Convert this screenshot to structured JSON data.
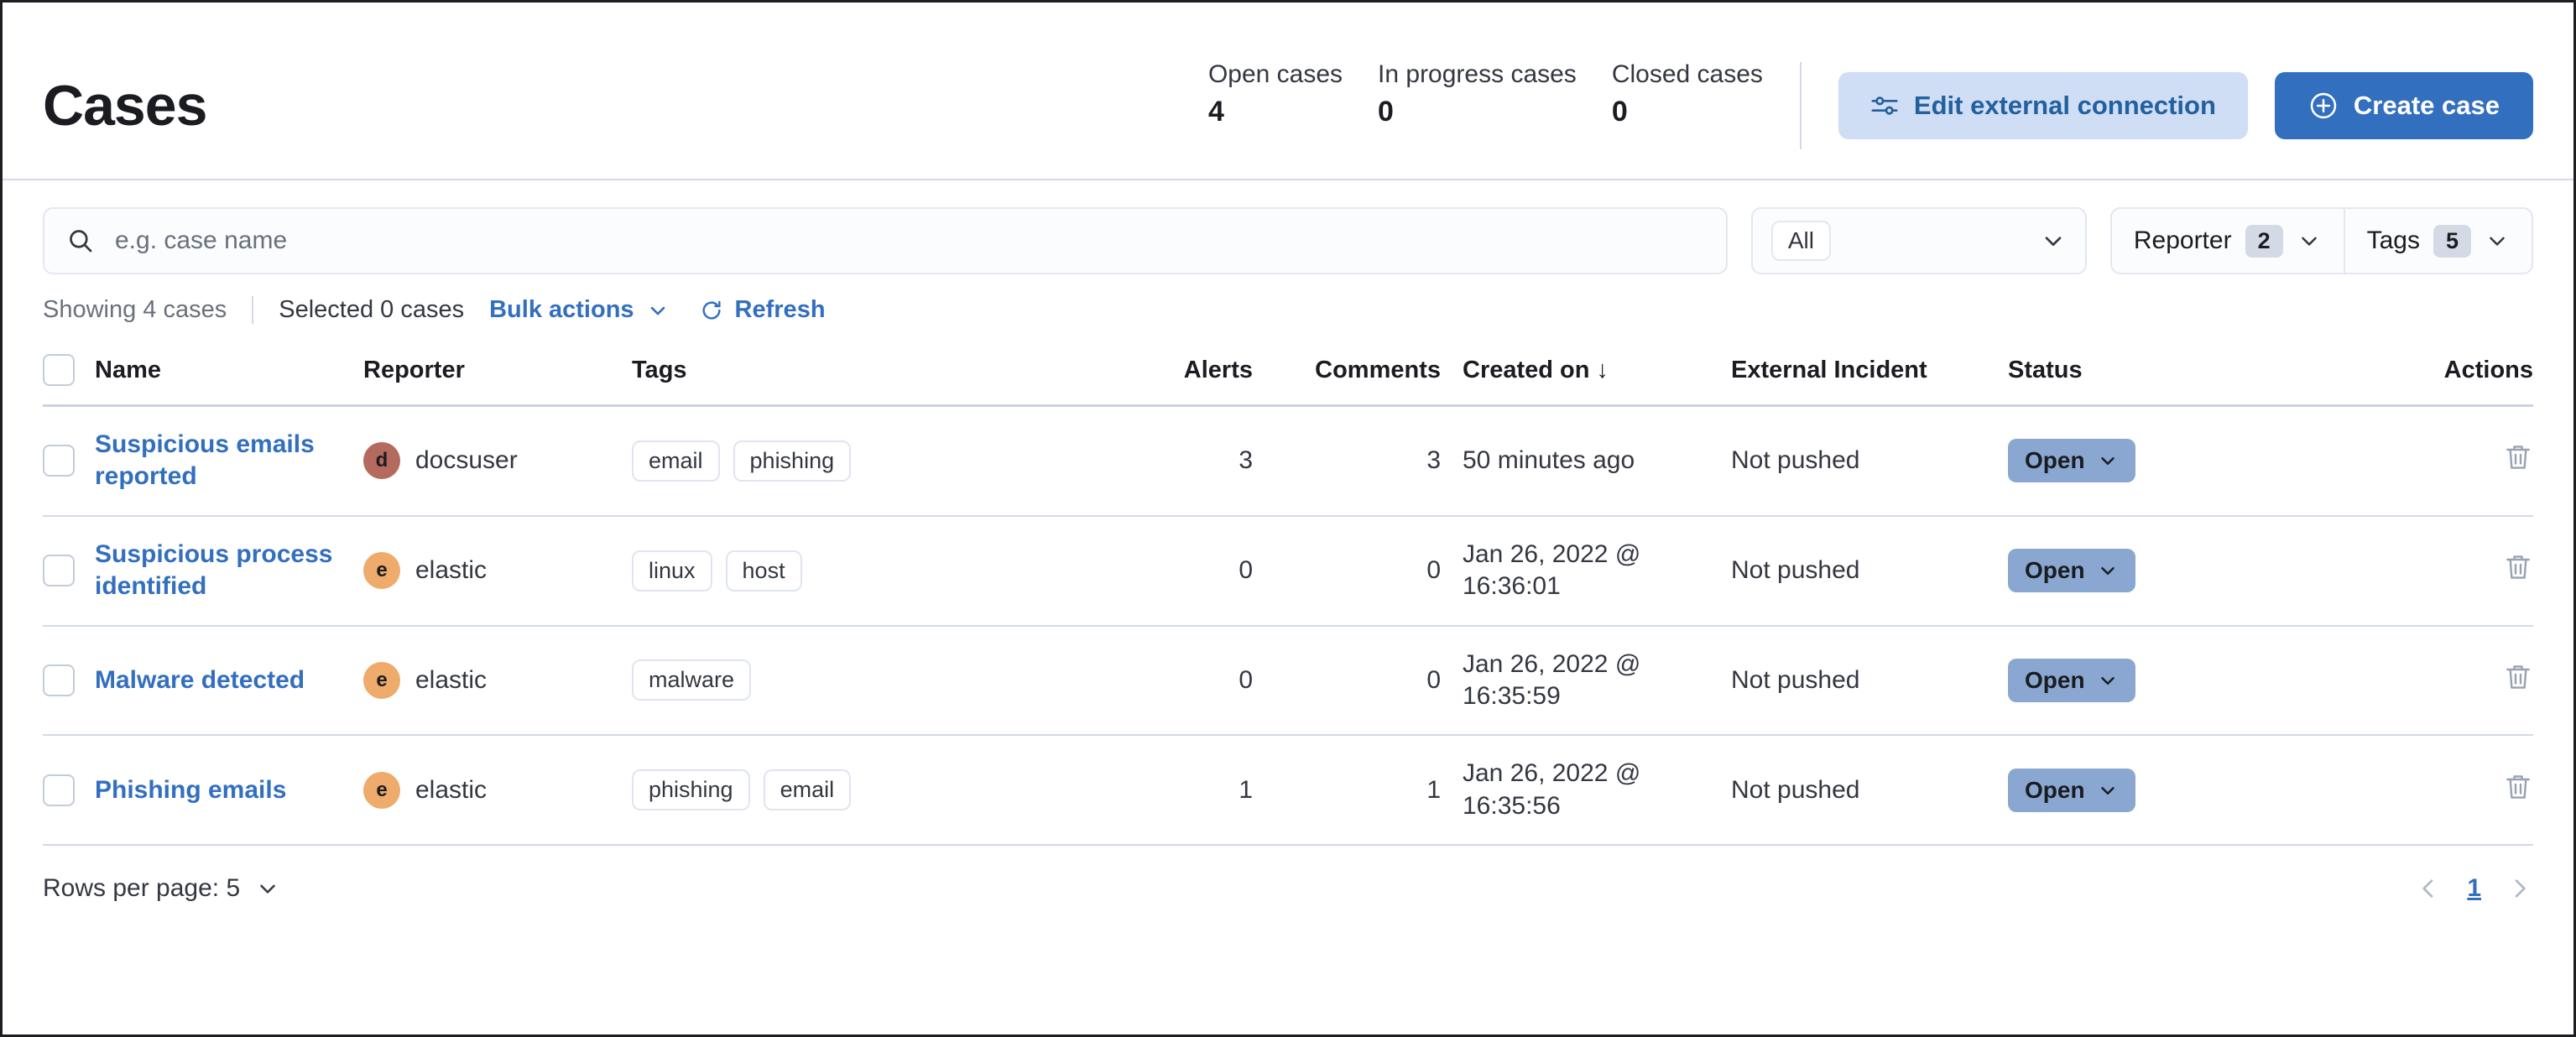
{
  "header": {
    "title": "Cases",
    "stats": [
      {
        "label": "Open cases",
        "value": "4"
      },
      {
        "label": "In progress cases",
        "value": "0"
      },
      {
        "label": "Closed cases",
        "value": "0"
      }
    ],
    "edit_connection_label": "Edit external connection",
    "create_case_label": "Create case",
    "accent_primary": "#336fbf",
    "accent_secondary_bg": "#cfddf5"
  },
  "filters": {
    "search_placeholder": "e.g. case name",
    "severity_value": "All",
    "reporter_label": "Reporter",
    "reporter_count": "2",
    "tags_label": "Tags",
    "tags_count": "5"
  },
  "toolbar": {
    "showing": "Showing 4 cases",
    "selected": "Selected 0 cases",
    "bulk_actions": "Bulk actions",
    "refresh": "Refresh"
  },
  "table": {
    "columns": {
      "name": "Name",
      "reporter": "Reporter",
      "tags": "Tags",
      "alerts": "Alerts",
      "comments": "Comments",
      "created_on": "Created on",
      "sort_arrow": "↓",
      "external_incident": "External Incident",
      "status": "Status",
      "actions": "Actions"
    },
    "rows": [
      {
        "name": "Suspicious emails reported",
        "reporter": "docsuser",
        "avatar_initial": "d",
        "avatar_color": "#b56a5e",
        "tags": [
          "email",
          "phishing"
        ],
        "alerts": "3",
        "comments": "3",
        "created_on": "50 minutes ago",
        "external_incident": "Not pushed",
        "status": "Open"
      },
      {
        "name": "Suspicious process identified",
        "reporter": "elastic",
        "avatar_initial": "e",
        "avatar_color": "#eeab6b",
        "tags": [
          "linux",
          "host"
        ],
        "alerts": "0",
        "comments": "0",
        "created_on": "Jan 26, 2022 @ 16:36:01",
        "external_incident": "Not pushed",
        "status": "Open"
      },
      {
        "name": "Malware detected",
        "reporter": "elastic",
        "avatar_initial": "e",
        "avatar_color": "#eeab6b",
        "tags": [
          "malware"
        ],
        "alerts": "0",
        "comments": "0",
        "created_on": "Jan 26, 2022 @ 16:35:59",
        "external_incident": "Not pushed",
        "status": "Open"
      },
      {
        "name": "Phishing emails",
        "reporter": "elastic",
        "avatar_initial": "e",
        "avatar_color": "#eeab6b",
        "tags": [
          "phishing",
          "email"
        ],
        "alerts": "1",
        "comments": "1",
        "created_on": "Jan 26, 2022 @ 16:35:56",
        "external_incident": "Not pushed",
        "status": "Open"
      }
    ]
  },
  "footer": {
    "rows_per_page": "Rows per page: 5",
    "current_page": "1"
  }
}
